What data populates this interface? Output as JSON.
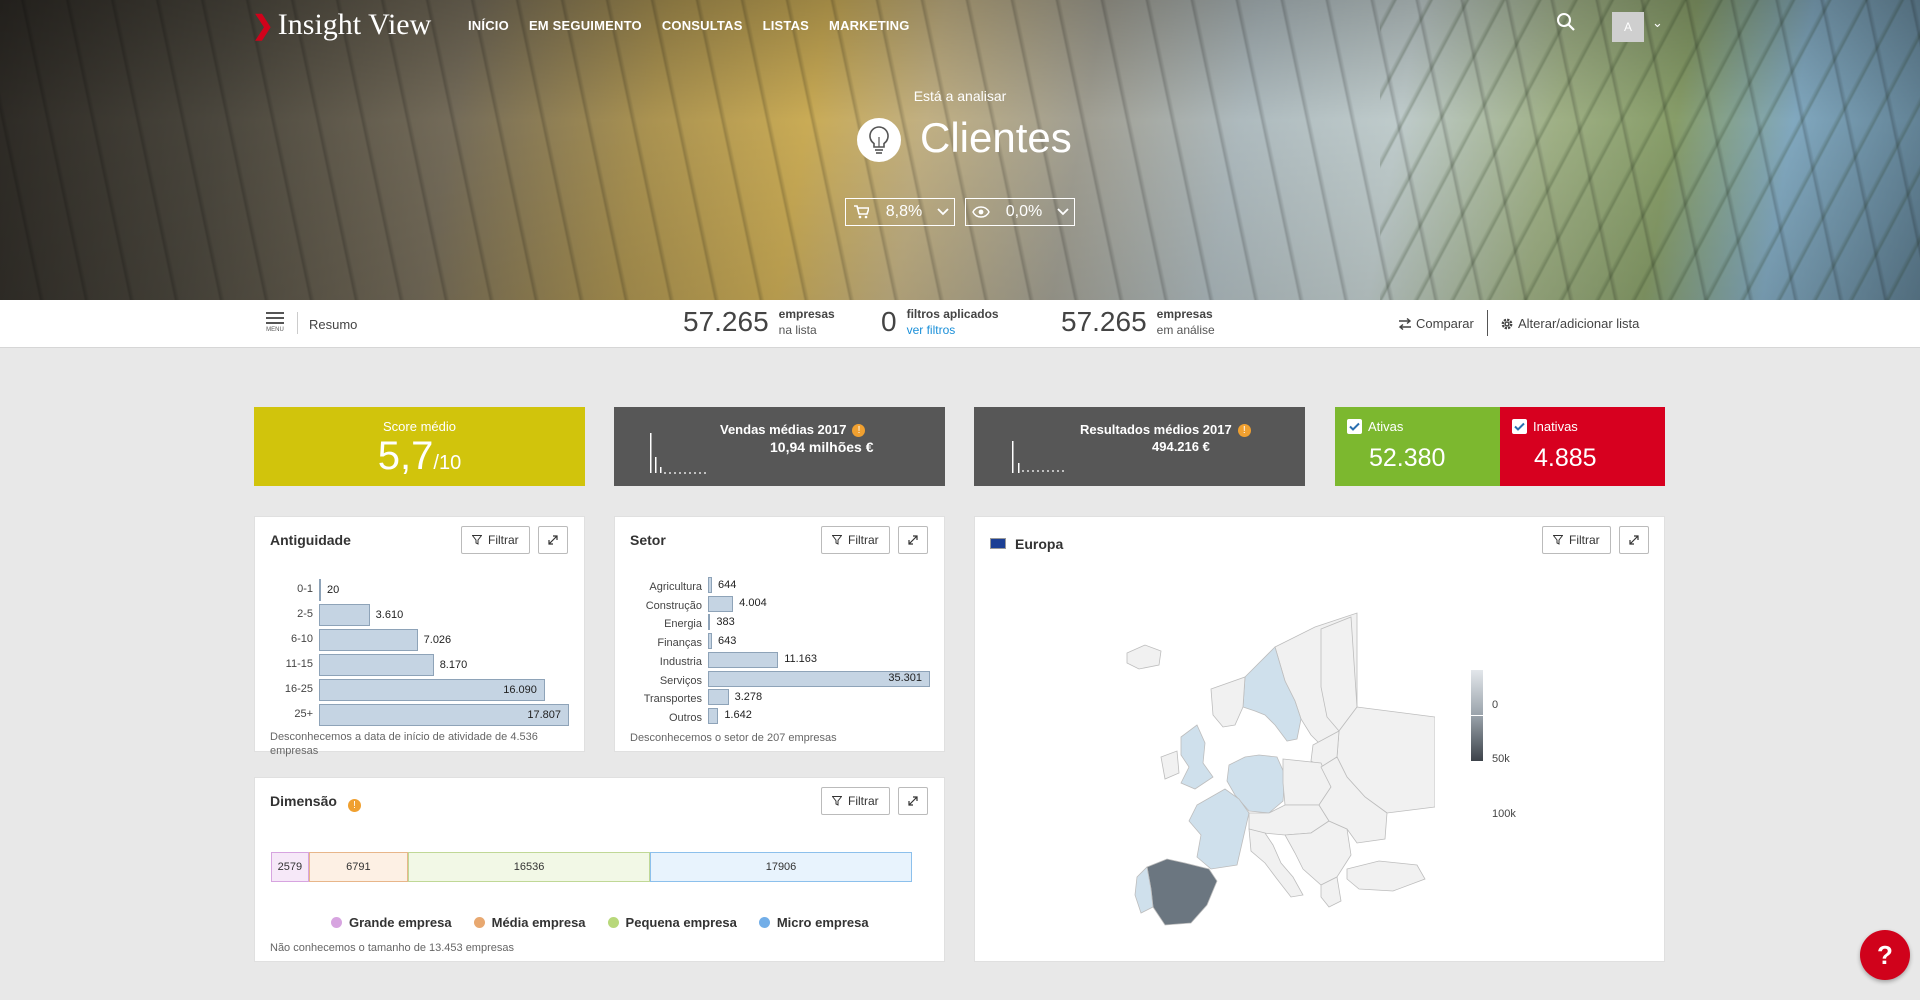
{
  "app": {
    "logo": "Insight View"
  },
  "nav": {
    "items": [
      "INÍCIO",
      "EM SEGUIMENTO",
      "CONSULTAS",
      "LISTAS",
      "MARKETING"
    ]
  },
  "user": {
    "avatar_initial": "A"
  },
  "hero": {
    "subtitle": "Está a analisar",
    "title": "Clientes",
    "pills": [
      {
        "icon": "cart-icon",
        "value": "8,8%"
      },
      {
        "icon": "eye-icon",
        "value": "0,0%"
      }
    ]
  },
  "summary": {
    "menu_label": "MENU",
    "section": "Resumo",
    "stats": [
      {
        "number": "57.265",
        "line1": "empresas",
        "line2": "na lista"
      },
      {
        "number": "0",
        "line1": "filtros aplicados",
        "line2": "ver filtros"
      },
      {
        "number": "57.265",
        "line1": "empresas",
        "line2": "em análise"
      }
    ],
    "compare": "Comparar",
    "change_list": "Alterar/adicionar lista"
  },
  "kpis": {
    "score": {
      "title": "Score médio",
      "value": "5,7",
      "suffix": "/10"
    },
    "sales": {
      "title": "Vendas médias 2017",
      "value": "10,94 milhões €"
    },
    "results": {
      "title": "Resultados médios 2017",
      "value": "494.216 €"
    },
    "active": {
      "label": "Ativas",
      "value": "52.380",
      "color": "#7cb82f"
    },
    "inactive": {
      "label": "Inativas",
      "value": "4.885",
      "color": "#d7001f"
    }
  },
  "antiguidade": {
    "title": "Antiguidade",
    "filter_label": "Filtrar",
    "note": "Desconhecemos a data de início de atividade de 4.536 empresas",
    "categories": [
      "0-1",
      "2-5",
      "6-10",
      "11-15",
      "16-25",
      "25+"
    ],
    "values": [
      20,
      3610,
      7026,
      8170,
      16090,
      17807
    ],
    "labels": [
      "20",
      "3.610",
      "7.026",
      "8.170",
      "16.090",
      "17.807"
    ]
  },
  "setor": {
    "title": "Setor",
    "filter_label": "Filtrar",
    "note": "Desconhecemos o setor de 207 empresas",
    "categories": [
      "Agricultura",
      "Construção",
      "Energia",
      "Finanças",
      "Industria",
      "Serviços",
      "Transportes",
      "Outros"
    ],
    "values": [
      644,
      4004,
      383,
      643,
      11163,
      35301,
      3278,
      1642
    ],
    "labels": [
      "644",
      "4.004",
      "383",
      "643",
      "11.163",
      "35.301",
      "3.278",
      "1.642"
    ]
  },
  "dimensao": {
    "title": "Dimensão",
    "filter_label": "Filtrar",
    "segments": [
      {
        "label": "2579",
        "value": 2579,
        "fill": "#f6e8f8",
        "border": "#d7a4e0"
      },
      {
        "label": "6791",
        "value": 6791,
        "fill": "#fdf0e4",
        "border": "#e8b68a"
      },
      {
        "label": "16536",
        "value": 16536,
        "fill": "#f2f8e6",
        "border": "#c0d896"
      },
      {
        "label": "17906",
        "value": 17906,
        "fill": "#e8f3fd",
        "border": "#8cc0ec"
      }
    ],
    "legend": [
      {
        "label": "Grande empresa",
        "color": "#d7a4e0"
      },
      {
        "label": "Média empresa",
        "color": "#e8a870"
      },
      {
        "label": "Pequena empresa",
        "color": "#b8d87a"
      },
      {
        "label": "Micro empresa",
        "color": "#72aee8"
      }
    ],
    "note": "Não conhecemos o tamanho de 13.453 empresas"
  },
  "europa": {
    "title": "Europa",
    "filter_label": "Filtrar",
    "scale_labels": [
      "0",
      "50k",
      "100k"
    ]
  },
  "help": {
    "label": "?"
  }
}
